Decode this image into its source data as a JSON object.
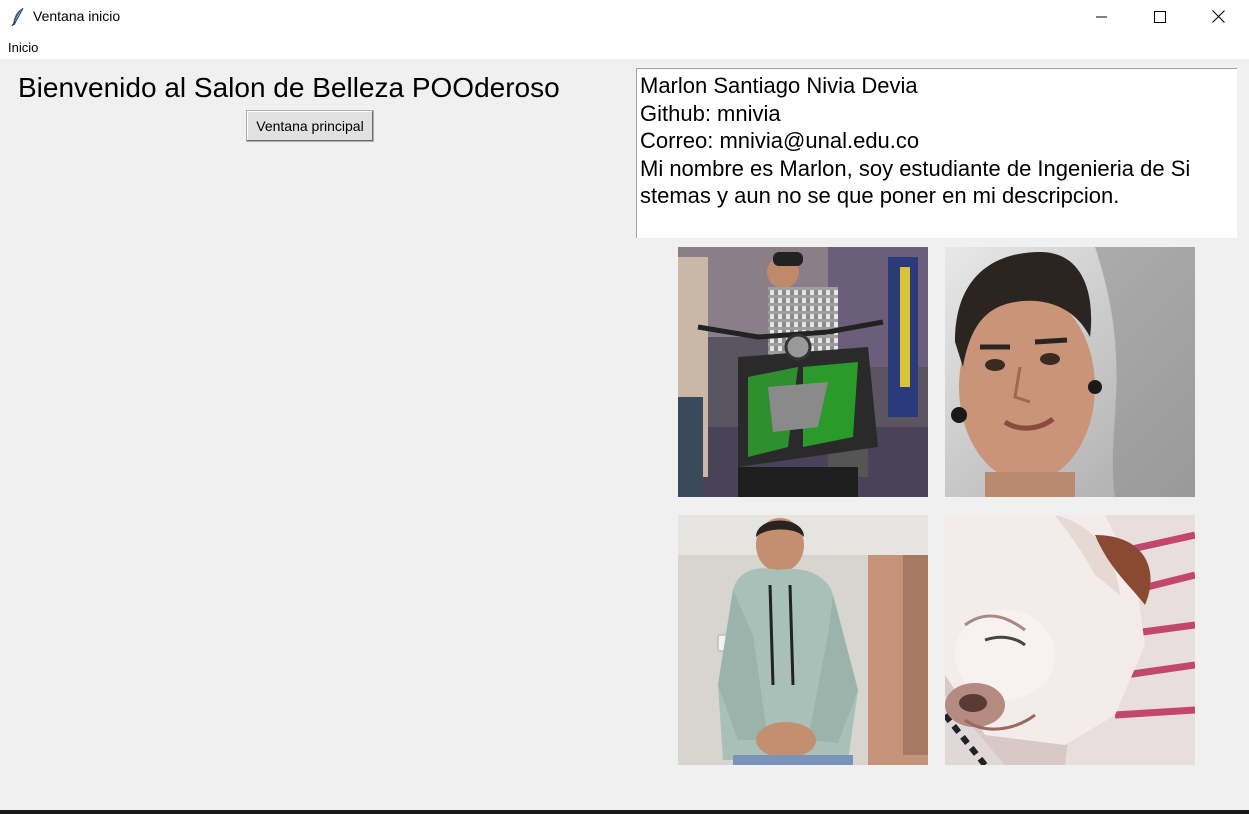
{
  "window": {
    "title": "Ventana inicio",
    "icon": "feather-icon"
  },
  "menu": {
    "items": [
      {
        "label": "Inicio"
      }
    ]
  },
  "main": {
    "welcome_text": "Bienvenido al Salon de Belleza POOderoso",
    "button_label": "Ventana principal"
  },
  "profile": {
    "lines": [
      "Marlon Santiago Nivia Devia",
      "Github: mnivia",
      "Correo: mnivia@unal.edu.co",
      "Mi nombre es Marlon, soy estudiante de Ingenieria de Si",
      "stemas y aun no se que poner en mi descripcion."
    ]
  },
  "photos": [
    {
      "subject": "person-on-motorcycle-photo"
    },
    {
      "subject": "selfie-photo"
    },
    {
      "subject": "person-in-hoodie-photo"
    },
    {
      "subject": "dog-sleeping-photo"
    }
  ],
  "colors": {
    "window_background": "#f0f0f0",
    "titlebar_background": "#ffffff",
    "text": "#000000"
  }
}
